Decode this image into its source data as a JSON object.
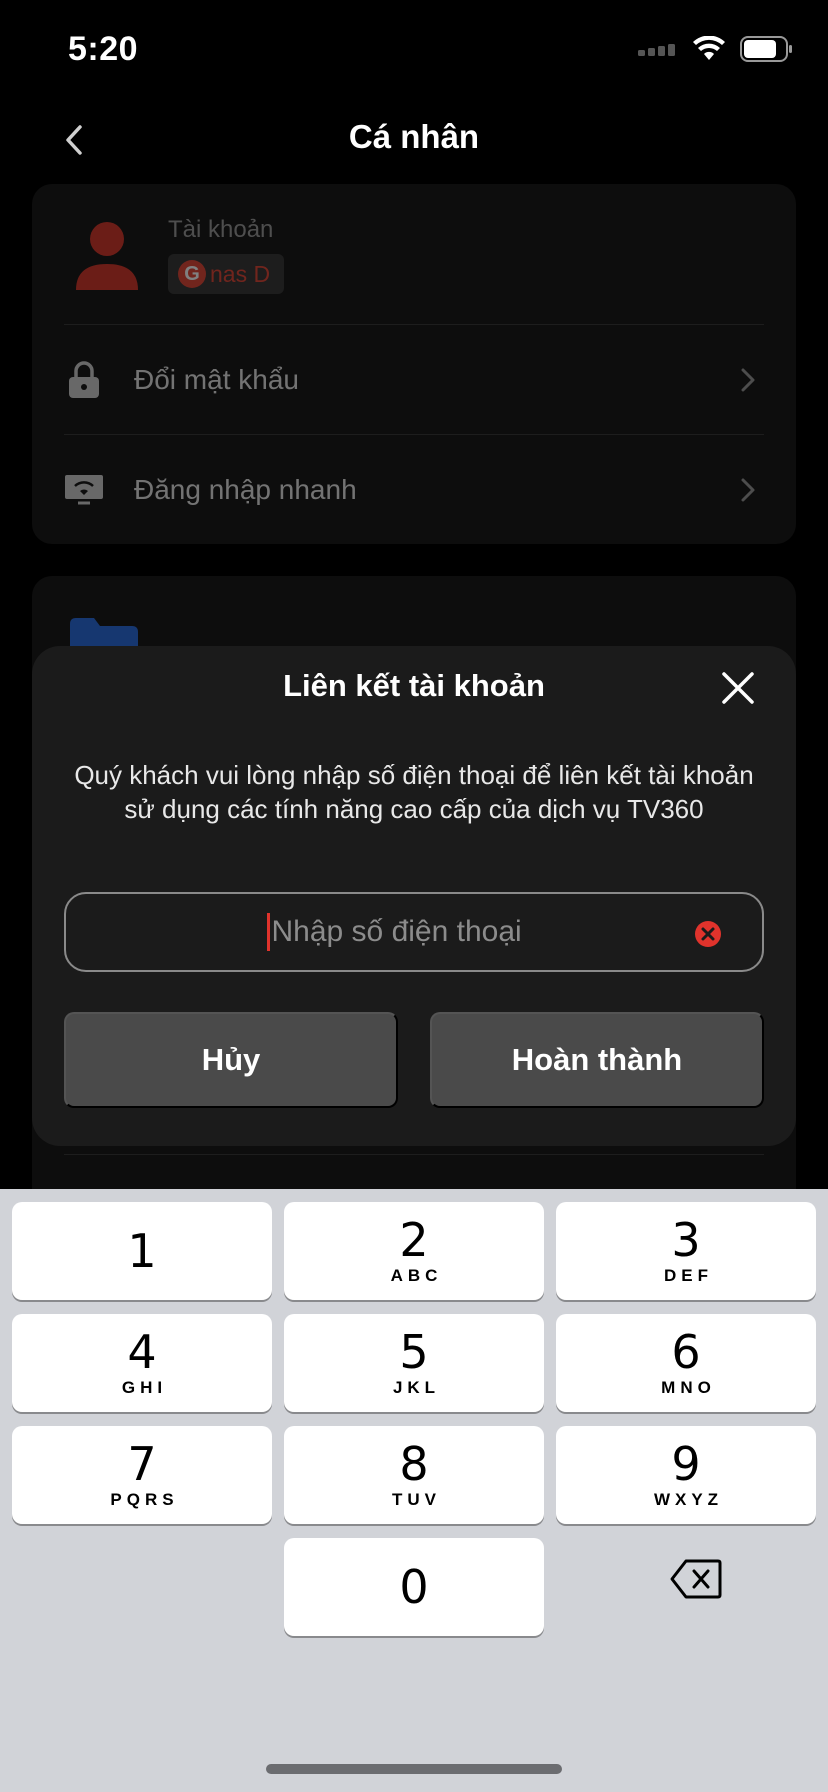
{
  "status_bar": {
    "time": "5:20"
  },
  "nav": {
    "title": "Cá nhân"
  },
  "profile": {
    "account_label": "Tài khoản",
    "account_name": "nas D",
    "provider_letter": "G"
  },
  "menu": {
    "items": [
      {
        "label": "Đổi mật khẩu",
        "icon": "lock-icon"
      },
      {
        "label": "Đăng nhập nhanh",
        "icon": "tv-icon"
      }
    ]
  },
  "modal": {
    "title": "Liên kết tài khoản",
    "description": "Quý khách vui lòng nhập số điện thoại để liên kết tài khoản sử dụng các tính năng cao cấp của dịch vụ TV360",
    "phone_placeholder": "Nhập số điện thoại",
    "phone_value": "",
    "cancel_label": "Hủy",
    "done_label": "Hoàn thành"
  },
  "keyboard": {
    "keys": [
      {
        "num": "1",
        "letters": ""
      },
      {
        "num": "2",
        "letters": "ABC"
      },
      {
        "num": "3",
        "letters": "DEF"
      },
      {
        "num": "4",
        "letters": "GHI"
      },
      {
        "num": "5",
        "letters": "JKL"
      },
      {
        "num": "6",
        "letters": "MNO"
      },
      {
        "num": "7",
        "letters": "PQRS"
      },
      {
        "num": "8",
        "letters": "TUV"
      },
      {
        "num": "9",
        "letters": "WXYZ"
      },
      {
        "num": "0",
        "letters": ""
      }
    ]
  },
  "colors": {
    "accent_red": "#e24a3b",
    "background": "#000000",
    "modal_bg": "#1b1b1b",
    "button_bg": "#4a4a4a",
    "keyboard_bg": "#d1d3d8"
  }
}
